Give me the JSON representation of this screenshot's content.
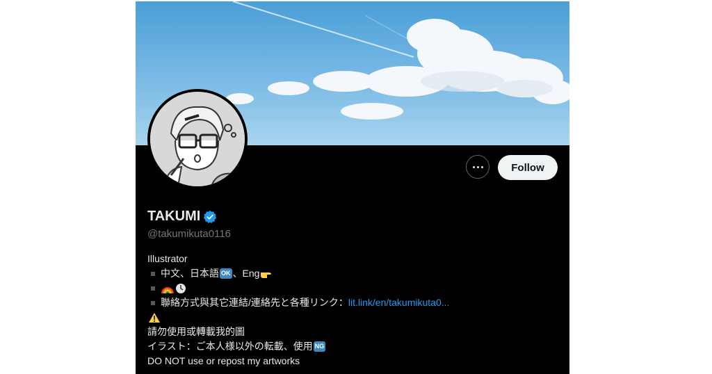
{
  "profile": {
    "name": "TAKUMI",
    "handle": "@takumikuta0116",
    "verified_icon": "verified-badge-icon",
    "accent_color": "#1d9bf0"
  },
  "actions": {
    "more_label": "More",
    "follow_label": "Follow"
  },
  "bio": {
    "line1": "Illustrator",
    "line2_text": "中文、日本語",
    "line2_ok": "OK",
    "line2_sep": "、Eng",
    "line4_text": "聯絡方式與其它連結/連絡先と各種リンク：",
    "line4_link": "lit.link/en/takumikuta0...",
    "line6": "請勿使用或轉載我的圖",
    "line7_text": "イラスト：ご本人様以外の転載、使用",
    "line7_ng": "NG",
    "line8": "DO NOT use or repost  my artworks"
  },
  "icons": {
    "banner": "sky-clouds-banner",
    "avatar": "illustrated-avatar",
    "point": "pointing-hand-icon",
    "rainbow": "rainbow-icon",
    "clock": "clock-icon",
    "warning": "warning-icon"
  }
}
